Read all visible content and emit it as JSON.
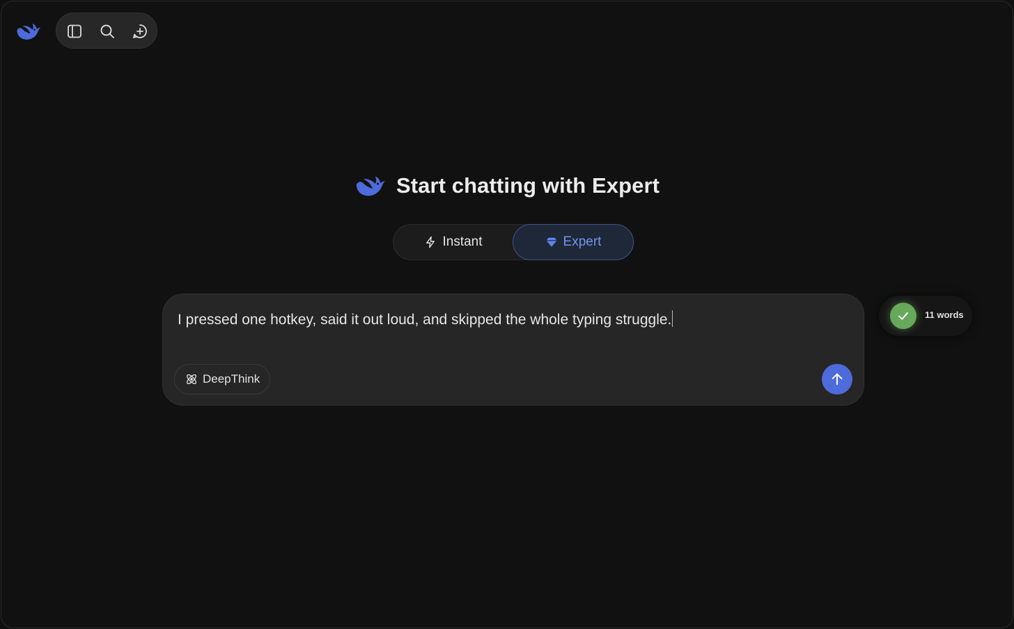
{
  "toolbar": {
    "icons": [
      "sidebar-toggle-icon",
      "search-icon",
      "new-chat-icon"
    ]
  },
  "hero": {
    "title": "Start chatting with Expert"
  },
  "modes": {
    "instant_label": "Instant",
    "expert_label": "Expert",
    "selected": "Expert"
  },
  "composer": {
    "value": "I pressed one hotkey, said it out loud, and skipped the whole typing struggle.",
    "deepthink_label": "DeepThink"
  },
  "word_counter": {
    "label": "11 words"
  },
  "colors": {
    "accent": "#4d6bdb",
    "expert_text": "#6f97ee",
    "success": "#67a85a",
    "background": "#111111"
  }
}
